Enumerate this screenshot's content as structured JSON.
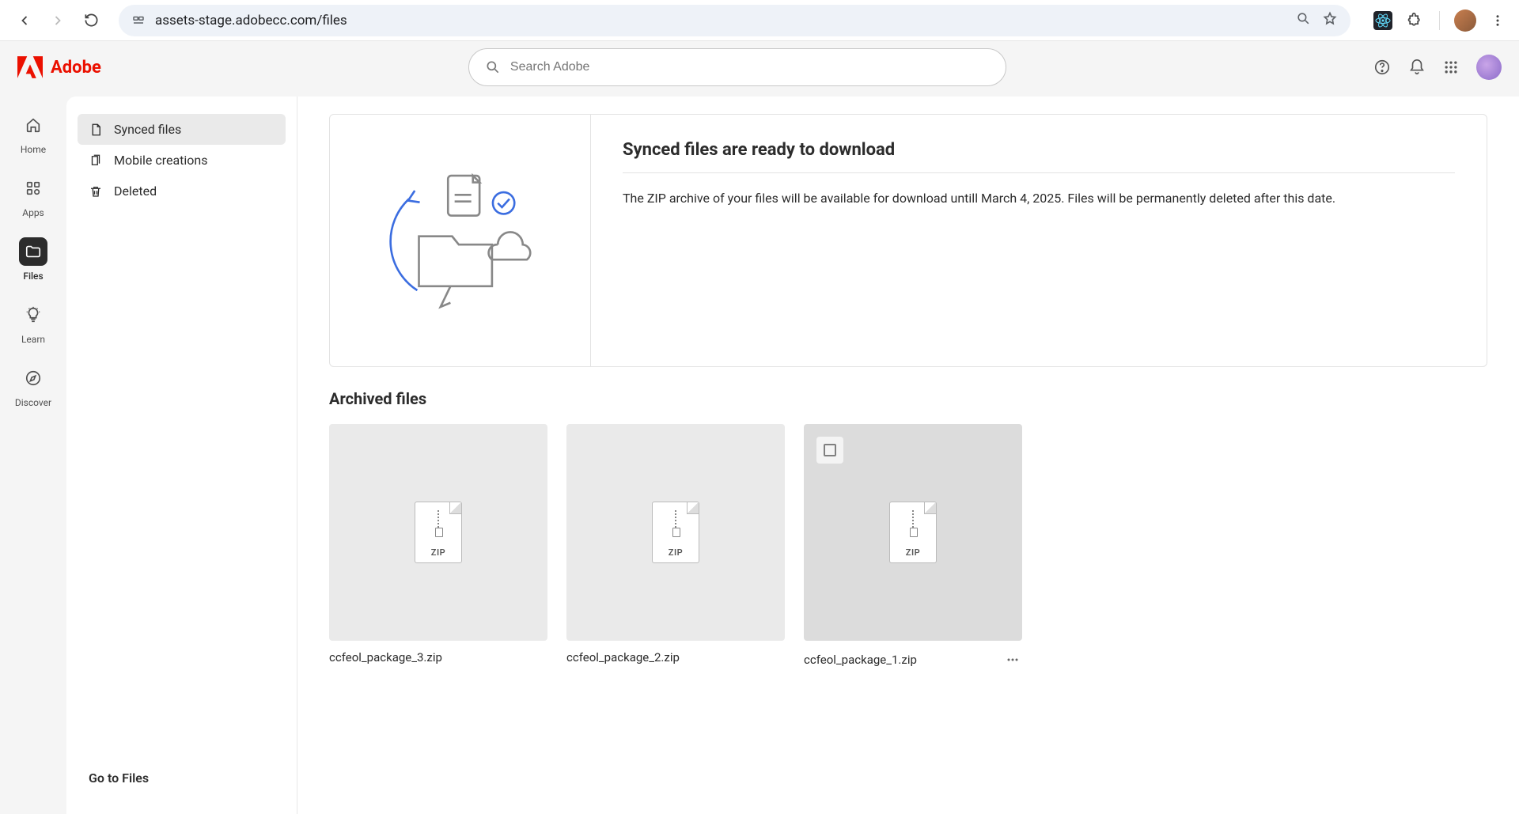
{
  "browser": {
    "url": "assets-stage.adobecc.com/files"
  },
  "brand": "Adobe",
  "search": {
    "placeholder": "Search Adobe"
  },
  "rail": {
    "items": [
      {
        "label": "Home"
      },
      {
        "label": "Apps"
      },
      {
        "label": "Files"
      },
      {
        "label": "Learn"
      },
      {
        "label": "Discover"
      }
    ]
  },
  "sidenav": {
    "items": [
      {
        "label": "Synced files"
      },
      {
        "label": "Mobile creations"
      },
      {
        "label": "Deleted"
      }
    ],
    "footer": "Go to Files"
  },
  "banner": {
    "title": "Synced files are ready to download",
    "body": "The ZIP archive of your files will be available for download untill March 4, 2025. Files will be permanently deleted after this date."
  },
  "section": {
    "title": "Archived files"
  },
  "files": [
    {
      "name": "ccfeol_package_3.zip",
      "type": "ZIP"
    },
    {
      "name": "ccfeol_package_2.zip",
      "type": "ZIP"
    },
    {
      "name": "ccfeol_package_1.zip",
      "type": "ZIP"
    }
  ],
  "colors": {
    "adobe_red": "#eb1000"
  }
}
